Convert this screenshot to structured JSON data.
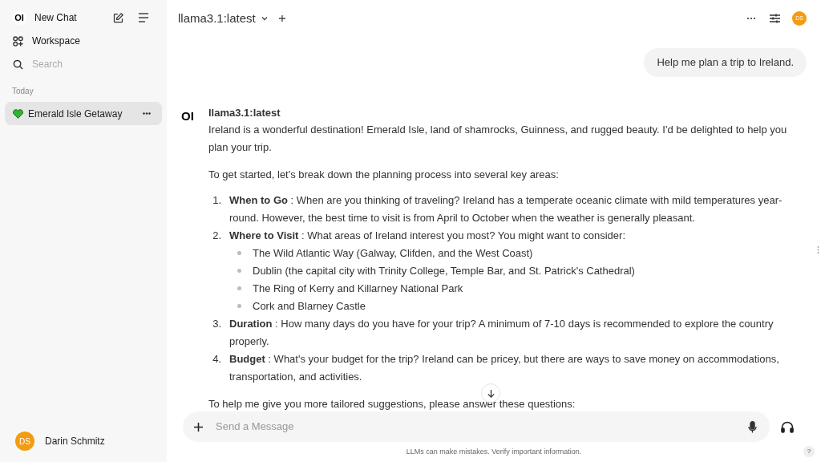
{
  "sidebar": {
    "logo": "OI",
    "new_chat": "New Chat",
    "workspace": "Workspace",
    "search": {
      "placeholder": "Search"
    },
    "section": "Today",
    "chats": [
      {
        "title": "Emerald Isle Getaway",
        "selected": true
      }
    ],
    "user": {
      "initials": "DS",
      "name": "Darin Schmitz"
    }
  },
  "header": {
    "model": "llama3.1:latest",
    "avatar": "DS"
  },
  "messages": [
    {
      "kind": "user",
      "text": "Help me plan a trip to Ireland."
    },
    {
      "kind": "assistant",
      "logo": "OI",
      "name": "llama3.1:latest",
      "blocks": [
        {
          "kind": "paragraph",
          "text": "Ireland is a wonderful destination! Emerald Isle, land of shamrocks, Guinness, and rugged beauty. I'd be delighted to help you plan your trip."
        },
        {
          "kind": "paragraph",
          "text": "To get started, let's break down the planning process into several key areas:"
        },
        {
          "kind": "list",
          "items": [
            {
              "number": "1.",
              "text": "**When to Go** : When are you thinking of traveling? Ireland has a temperate oceanic climate with mild temperatures year-round. However, the best time to visit is from April to October when the weather is generally pleasant."
            },
            {
              "number": "2.",
              "text": "**Where to Visit** : What areas of Ireland interest you most? You might want to consider:",
              "children": [
                "The Wild Atlantic Way (Galway, Clifden, and the West Coast)",
                "Dublin (the capital city with Trinity College, Temple Bar, and St. Patrick's Cathedral)",
                "The Ring of Kerry and Killarney National Park",
                "Cork and Blarney Castle"
              ]
            },
            {
              "number": "3.",
              "text": "**Duration** : How many days do you have for your trip? A minimum of 7-10 days is recommended to explore the country properly."
            },
            {
              "number": "4.",
              "text": "**Budget** : What's your budget for the trip? Ireland can be pricey, but there are ways to save money on accommodations, transportation, and activities."
            }
          ]
        },
        {
          "kind": "paragraph",
          "text": "To help me give you more tailored suggestions, please answer these questions:"
        }
      ]
    }
  ],
  "composer": {
    "placeholder": "Send a Message"
  },
  "disclaimer": "LLMs can make mistakes. Verify important information.",
  "help": "?"
}
